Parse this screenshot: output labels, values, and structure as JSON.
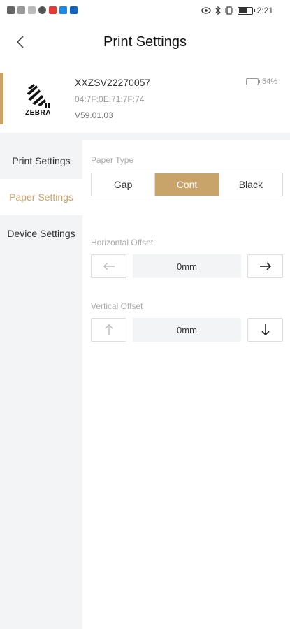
{
  "status_bar": {
    "time": "2:21",
    "icons": [
      "signal-icon",
      "wifi-icon",
      "app-icon",
      "shield-icon",
      "search-icon",
      "store-icon",
      "eye-icon",
      "bluetooth-icon",
      "vibrate-icon",
      "battery-icon"
    ]
  },
  "header": {
    "title": "Print Settings",
    "back_icon": "chevron-left-icon"
  },
  "device": {
    "brand": "ZEBRA",
    "name": "XXZSV22270057",
    "mac": "04:7F:0E:71:7F:74",
    "version": "V59.01.03",
    "battery": "54%",
    "accent_color": "#c8a46b"
  },
  "sidebar": {
    "items": [
      {
        "label": "Print Settings",
        "active": false
      },
      {
        "label": "Paper Settings",
        "active": true
      },
      {
        "label": "Device Settings",
        "active": false
      }
    ]
  },
  "paper_type": {
    "label": "Paper Type",
    "options": [
      "Gap",
      "Cont",
      "Black"
    ],
    "selected": "Cont"
  },
  "horizontal_offset": {
    "label": "Horizontal Offset",
    "value": "0mm",
    "decrease_icon": "arrow-left-icon",
    "increase_icon": "arrow-right-icon"
  },
  "vertical_offset": {
    "label": "Vertical Offset",
    "value": "0mm",
    "decrease_icon": "arrow-up-icon",
    "increase_icon": "arrow-down-icon"
  },
  "colors": {
    "accent": "#c8a46b",
    "sidebar_bg": "#f3f4f6"
  }
}
